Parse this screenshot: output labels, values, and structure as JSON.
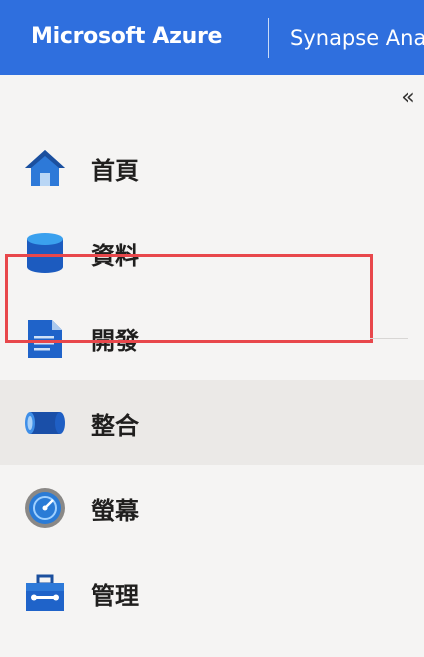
{
  "header": {
    "brand": "Microsoft Azure",
    "product": "Synapse Analytics"
  },
  "sidebar": {
    "collapse_glyph": "«",
    "items": [
      {
        "label": "首頁",
        "icon": "home-icon"
      },
      {
        "label": "資料",
        "icon": "data-cylinder-icon"
      },
      {
        "label": "開發",
        "icon": "document-icon"
      },
      {
        "label": "整合",
        "icon": "pipeline-icon",
        "selected": true
      },
      {
        "label": "螢幕",
        "icon": "monitor-gauge-icon"
      },
      {
        "label": "管理",
        "icon": "toolbox-icon"
      }
    ]
  },
  "colors": {
    "header_bg": "#2f6fde",
    "highlight_border": "#e8474b",
    "selected_bg": "#ebe9e7"
  }
}
